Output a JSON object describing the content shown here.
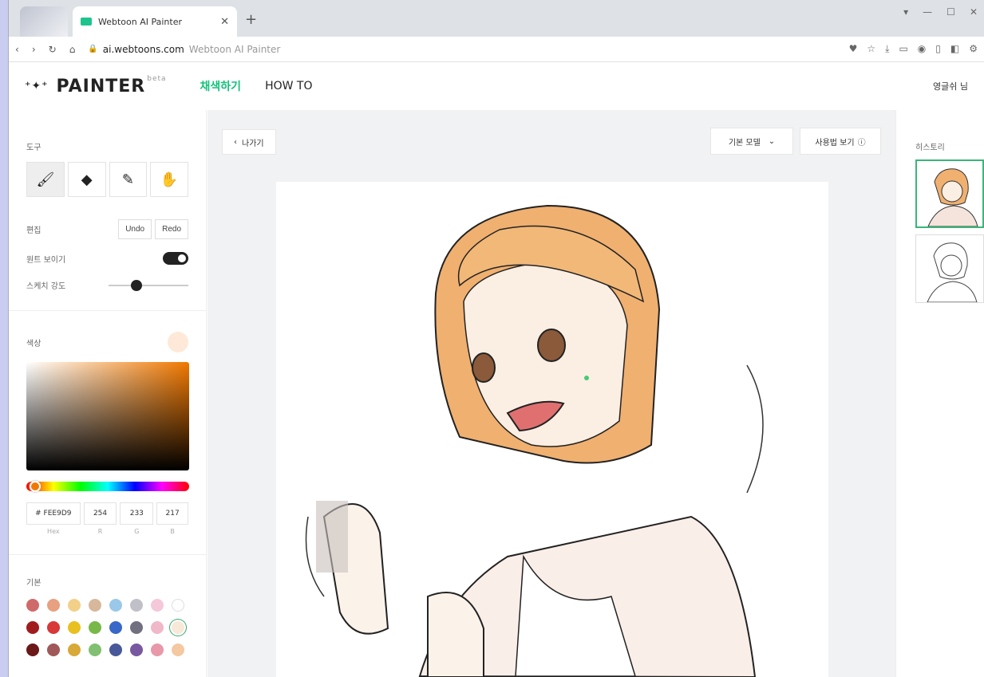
{
  "browser": {
    "tab_title": "Webtoon AI Painter",
    "url": "ai.webtoons.com",
    "url_sub": "Webtoon AI Painter"
  },
  "header": {
    "logo": "PAINTER",
    "beta": "beta",
    "nav_color": "채색하기",
    "nav_howto": "HOW TO",
    "user": "영글쉬 님"
  },
  "left": {
    "tools_label": "도구",
    "edit_label": "편집",
    "undo": "Undo",
    "redo": "Redo",
    "sketch_label": "원트 보이기",
    "strength_label": "스케치 강도",
    "color_label": "색상",
    "hex": "# FEE9D9",
    "r": "254",
    "g": "233",
    "b": "217",
    "hex_label": "Hex",
    "r_label": "R",
    "g_label": "G",
    "b_label": "B",
    "basic_label": "기본",
    "selected_color": "#FEE9D9",
    "strength_value": 0.35,
    "palette": [
      "#d06a6a",
      "#e8a080",
      "#f2d088",
      "#d8b89a",
      "#9ac8e8",
      "#c0c0c8",
      "#f4c8d8",
      "#ffffff",
      "#a01c1c",
      "#d83838",
      "#e8c020",
      "#78b848",
      "#3868c8",
      "#707080",
      "#f0b8c8",
      "#f8e8d8",
      "#6a1818",
      "#a05858",
      "#d8a838",
      "#80c070",
      "#485898",
      "#7858a0",
      "#e898a8",
      "#f4c8a0"
    ]
  },
  "center": {
    "back": "나가기",
    "model": "기본 모델",
    "guide": "사용법 보기"
  },
  "right": {
    "history_label": "히스토리"
  }
}
